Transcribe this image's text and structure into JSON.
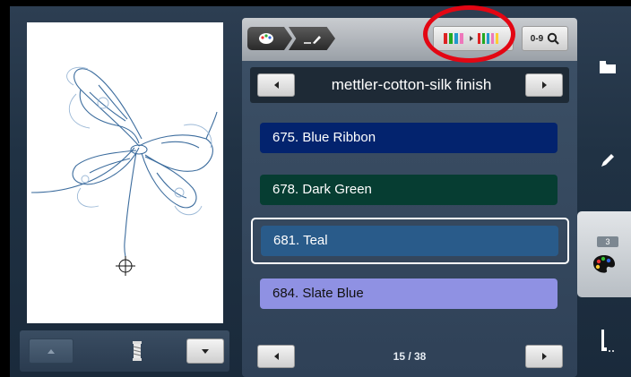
{
  "header": {
    "brand_name": "mettler-cotton-silk finish",
    "search_label": "0-9"
  },
  "colors": {
    "highlight_ring": "#e30613"
  },
  "thread_list": [
    {
      "label": "675. Blue Ribbon",
      "swatch": "#03236e",
      "text_color": "#ffffff",
      "selected": false
    },
    {
      "label": "678. Dark Green",
      "swatch": "#063d32",
      "text_color": "#ffffff",
      "selected": false
    },
    {
      "label": "681. Teal",
      "swatch": "#295b8a",
      "text_color": "#ffffff",
      "selected": true
    },
    {
      "label": "684. Slate Blue",
      "swatch": "#8f91e3",
      "text_color": "#111111",
      "selected": false
    }
  ],
  "pagination": {
    "page": "15 / 38"
  },
  "sidebar": {
    "items": [
      {
        "name": "folder-icon"
      },
      {
        "name": "pencil-icon"
      },
      {
        "name": "palette-icon",
        "badge": "3",
        "active": true
      },
      {
        "name": "presser-foot-icon"
      }
    ]
  }
}
